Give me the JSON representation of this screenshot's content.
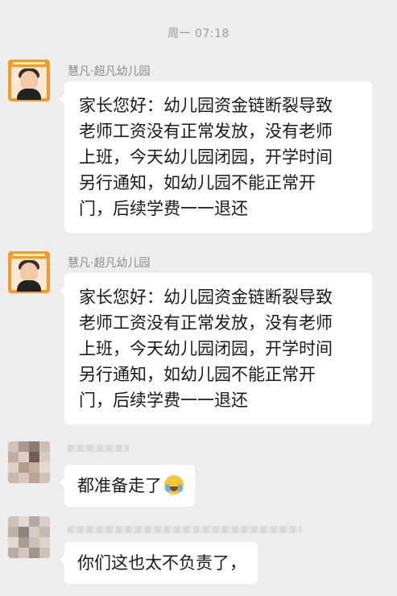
{
  "timestamp": "周一 07:18",
  "messages": [
    {
      "sender": "慧凡·超凡幼儿园",
      "lines": [
        "家长您好：幼儿园资金链断裂导致",
        "老师工资没有正常发放，没有老师",
        "上班，今天幼儿园闭园，开学时间",
        "另行通知，如幼儿园不能正常开",
        "门，后续学费一一退还"
      ]
    },
    {
      "sender": "慧凡·超凡幼儿园",
      "lines": [
        "家长您好：幼儿园资金链断裂导致",
        "老师工资没有正常发放，没有老师",
        "上班，今天幼儿园闭园，开学时间",
        "另行通知，如幼儿园不能正常开",
        "门，后续学费一一退还"
      ]
    },
    {
      "sender": "",
      "text": "都准备走了",
      "emoji": "crying-laughing-emoji"
    },
    {
      "sender": "",
      "text": "你们这也太不负责了，"
    }
  ],
  "colors": {
    "background": "#ededed",
    "bubble": "#ffffff",
    "avatar_orange": "#f39a2c",
    "sender_text": "#8c8c8c",
    "timestamp_text": "#9b9b9b"
  }
}
